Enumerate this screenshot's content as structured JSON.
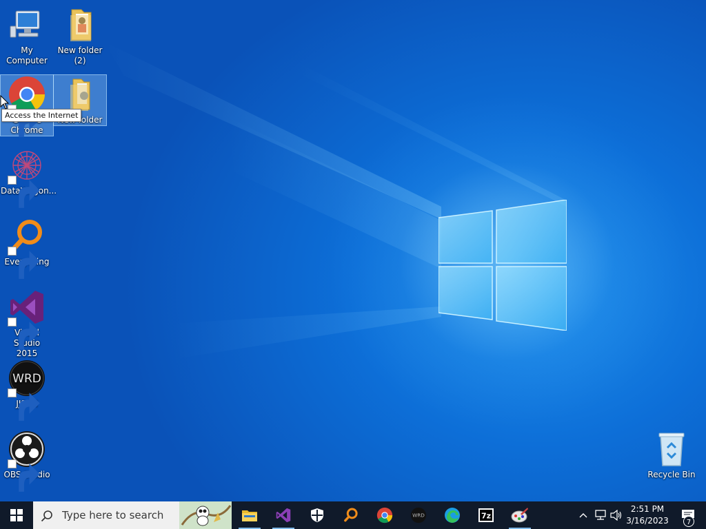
{
  "desktop": {
    "icons": [
      {
        "id": "my-computer",
        "label": "My Computer",
        "icon": "computer-icon"
      },
      {
        "id": "new-folder-2",
        "label": "New folder\n(2)",
        "icon": "folder-icon"
      },
      {
        "id": "google-chrome",
        "label": "Google\nChrome",
        "icon": "chrome-icon",
        "shortcut": true,
        "selected": true
      },
      {
        "id": "new-folder",
        "label": "New folder",
        "icon": "folder-icon",
        "selected": true
      },
      {
        "id": "datawagon",
        "label": "DataWagon...",
        "icon": "datawagon-icon",
        "shortcut": true
      },
      {
        "id": "everything",
        "label": "Everything",
        "icon": "everything-search-icon",
        "shortcut": true
      },
      {
        "id": "visual-studio",
        "label": "Visual Studio\n2015",
        "icon": "visual-studio-icon",
        "shortcut": true
      },
      {
        "id": "jjs-ui",
        "label": "JJS-UI",
        "icon": "wrd-icon",
        "shortcut": true
      },
      {
        "id": "obs-studio",
        "label": "OBS Studio",
        "icon": "obs-icon",
        "shortcut": true
      },
      {
        "id": "recycle-bin",
        "label": "Recycle Bin",
        "icon": "recycle-bin-icon"
      }
    ],
    "tooltip": "Access the Internet"
  },
  "taskbar": {
    "search_placeholder": "Type here to search",
    "pinned": [
      "file-explorer-icon",
      "visual-studio-icon",
      "windows-security-icon",
      "everything-search-icon",
      "chrome-icon",
      "wrd-icon",
      "edge-icon",
      "7zip-icon",
      "paint-app-icon"
    ],
    "seven_zip_label": "7z",
    "wrd_label": "WRD",
    "tray": {
      "time": "2:51 PM",
      "date": "3/16/2023",
      "notification_count": "7"
    }
  },
  "colors": {
    "taskbar_bg": "#101a2a",
    "desktop_accent": "#0d6fd8",
    "search_bg": "#f0f0f0"
  }
}
